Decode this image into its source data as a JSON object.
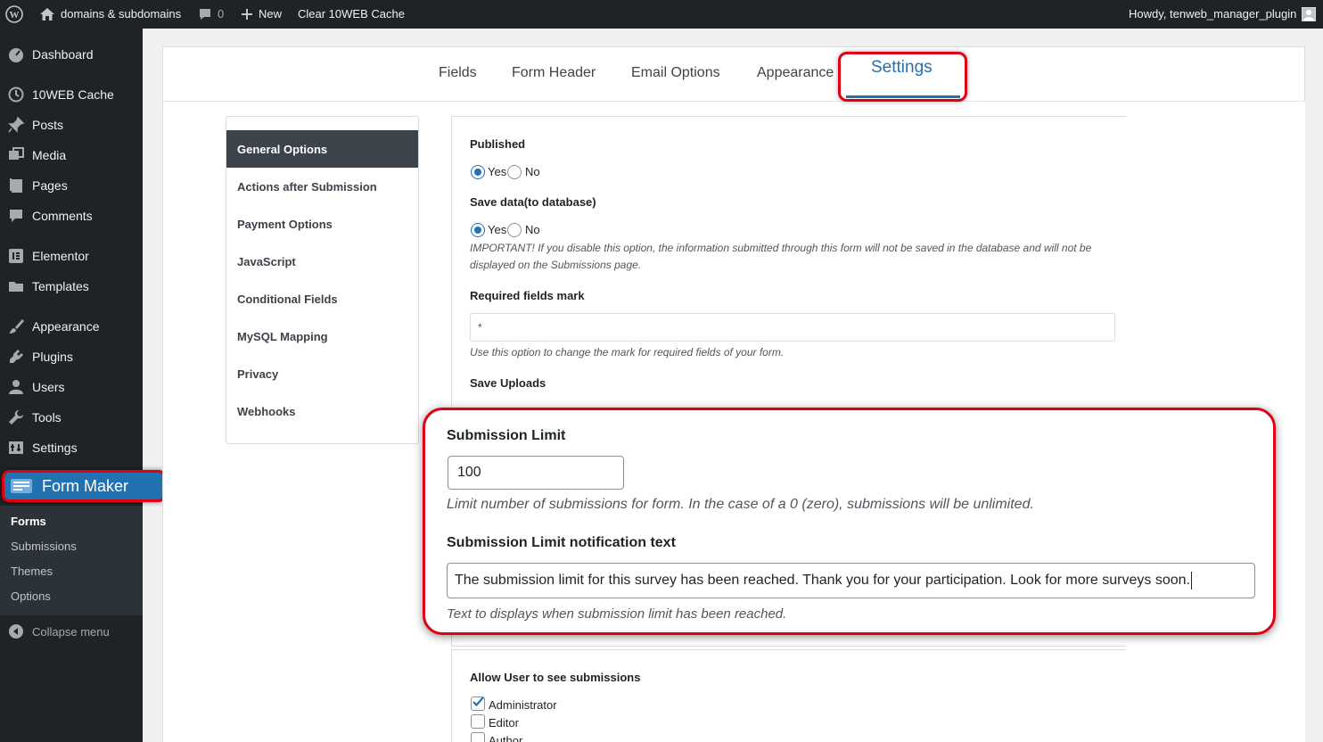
{
  "adminbar": {
    "wp_logo_icon": "wordpress-icon",
    "site_name": "domains & subdomains",
    "comments_count": "0",
    "new_label": "New",
    "cache_label": "Clear 10WEB Cache",
    "howdy": "Howdy, tenweb_manager_plugin"
  },
  "sidebar": {
    "items": [
      {
        "label": "Dashboard",
        "icon": "dashboard-icon"
      },
      {
        "label": "10WEB Cache",
        "icon": "cache-icon"
      },
      {
        "label": "Posts",
        "icon": "pin-icon"
      },
      {
        "label": "Media",
        "icon": "media-icon"
      },
      {
        "label": "Pages",
        "icon": "pages-icon"
      },
      {
        "label": "Comments",
        "icon": "comments-icon"
      },
      {
        "label": "Elementor",
        "icon": "elementor-icon"
      },
      {
        "label": "Templates",
        "icon": "folder-icon"
      },
      {
        "label": "Appearance",
        "icon": "brush-icon"
      },
      {
        "label": "Plugins",
        "icon": "plugin-icon"
      },
      {
        "label": "Users",
        "icon": "users-icon"
      },
      {
        "label": "Tools",
        "icon": "wrench-icon"
      },
      {
        "label": "Settings",
        "icon": "settings-icon"
      }
    ],
    "form_maker": "Form Maker",
    "submenu": [
      "Forms",
      "Submissions",
      "Themes",
      "Options"
    ],
    "collapse": "Collapse menu"
  },
  "tabs": [
    "Fields",
    "Form Header",
    "Email Options",
    "Appearance",
    "Settings"
  ],
  "side_tabs": [
    "General Options",
    "Actions after Submission",
    "Payment Options",
    "JavaScript",
    "Conditional Fields",
    "MySQL Mapping",
    "Privacy",
    "Webhooks"
  ],
  "options": {
    "published": {
      "label": "Published",
      "yes": "Yes",
      "no": "No",
      "selected": "Yes"
    },
    "save_data": {
      "label": "Save data(to database)",
      "yes": "Yes",
      "no": "No",
      "selected": "Yes",
      "desc": "IMPORTANT! If you disable this option, the information submitted through this form will not be saved in the database and will not be displayed on the Submissions page."
    },
    "required_mark": {
      "label": "Required fields mark",
      "value": "*",
      "desc": "Use this option to change the mark for required fields of your form."
    },
    "save_uploads": {
      "label": "Save Uploads"
    },
    "allow_user": {
      "label": "Allow User to see submissions",
      "roles": [
        "Administrator",
        "Editor",
        "Author"
      ],
      "checked": [
        "Administrator"
      ]
    }
  },
  "callout": {
    "limit_label": "Submission Limit",
    "limit_value": "100",
    "limit_desc": "Limit number of submissions for form. In the case of a 0 (zero), submissions will be unlimited.",
    "notif_label": "Submission Limit notification text",
    "notif_value": "The submission limit for this survey has been reached. Thank you for your participation. Look for more surveys soon.",
    "notif_desc": "Text to displays when submission limit has been reached."
  },
  "colors": {
    "accent": "#2271b1",
    "highlight": "#e00012",
    "admin_dark": "#1d2327"
  }
}
